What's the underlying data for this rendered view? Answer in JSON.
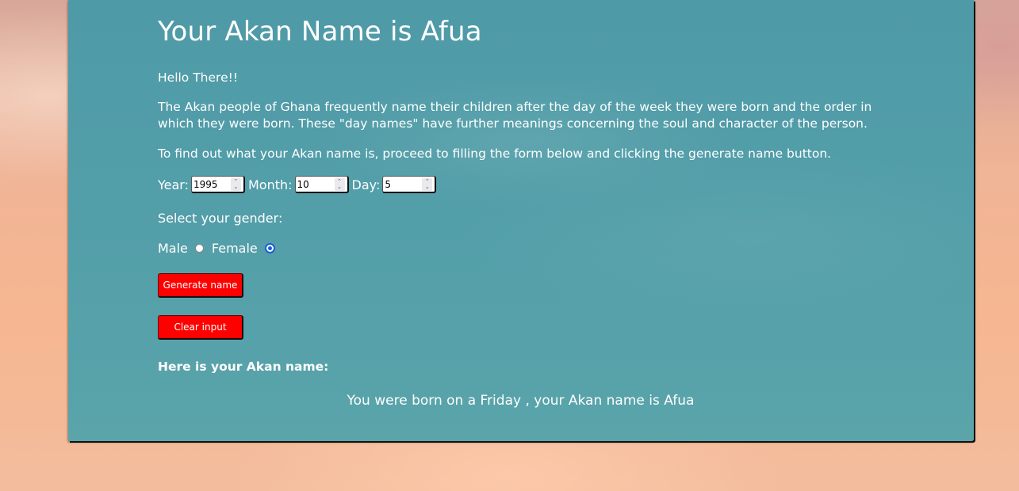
{
  "page": {
    "title": "Your Akan Name is Afua",
    "greeting": "Hello There!!",
    "intro": "The Akan people of Ghana frequently name their children after the day of the week they were born and the order in which they were born. These \"day names\" have further meanings concerning the soul and character of the person.",
    "instructions": "To find out what your Akan name is, proceed to filling the form below and clicking the generate name button."
  },
  "form": {
    "year_label": "Year:",
    "year_value": "1995",
    "month_label": "Month:",
    "month_value": "10",
    "day_label": "Day:",
    "day_value": "5",
    "gender_prompt": "Select your gender:",
    "male_label": "Male",
    "female_label": "Female",
    "selected_gender": "Female",
    "generate_button": "Generate name",
    "clear_button": "Clear input"
  },
  "result": {
    "label": "Here is your Akan name:",
    "message": "You were born on a Friday , your Akan name is Afua"
  },
  "colors": {
    "panel": "#529ea9",
    "button": "#ff0000",
    "text": "#ffffff"
  }
}
